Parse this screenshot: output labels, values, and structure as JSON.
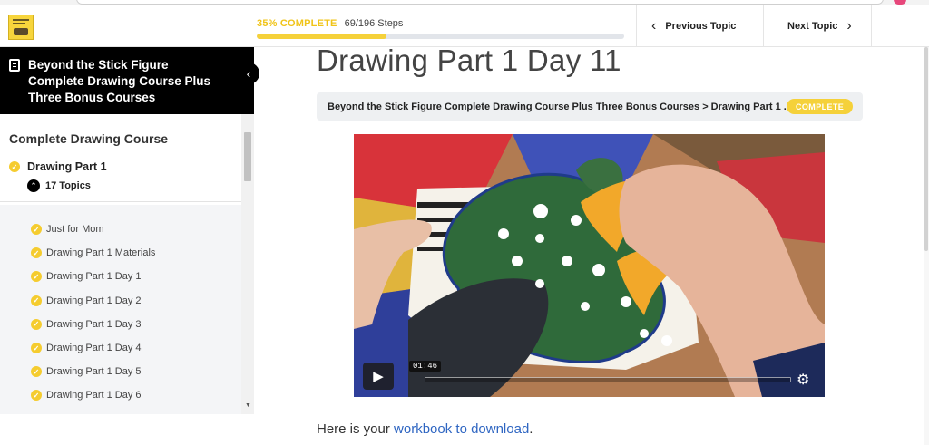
{
  "header": {
    "progress": {
      "percent_label": "35% COMPLETE",
      "steps_label": "69/196 Steps",
      "fraction": 0.352
    },
    "prev_label": "Previous Topic",
    "next_label": "Next Topic"
  },
  "sidebar": {
    "course_title": "Beyond the Stick Figure Complete Drawing Course Plus Three Bonus Courses",
    "section_heading": "Complete Drawing Course",
    "lesson_title": "Drawing Part 1",
    "topics_count_label": "17 Topics",
    "topics": [
      "Just for Mom",
      "Drawing Part 1 Materials",
      "Drawing Part 1 Day 1",
      "Drawing Part 1 Day 2",
      "Drawing Part 1 Day 3",
      "Drawing Part 1 Day 4",
      "Drawing Part 1 Day 5",
      "Drawing Part 1 Day 6"
    ]
  },
  "main": {
    "title": "Drawing Part 1 Day 11",
    "breadcrumb": "Beyond the Stick Figure Complete Drawing Course Plus Three Bonus Courses > Drawing Part 1 ...",
    "status_badge": "COMPLETE",
    "video": {
      "time_tooltip": "01:46"
    },
    "workbook_prefix": "Here is your ",
    "workbook_link": "workbook to download",
    "workbook_suffix": "."
  },
  "colors": {
    "accent_yellow": "#f5d13a",
    "link_blue": "#2f66c2",
    "sidebar_header_bg": "#000000"
  },
  "icons": {
    "logo": "course-logo",
    "sidebar_title": "document-icon",
    "collapse": "chevron-left-icon",
    "check": "check-circle-icon",
    "topics_toggle": "chevron-up-icon",
    "play": "play-icon",
    "settings": "gear-icon"
  }
}
